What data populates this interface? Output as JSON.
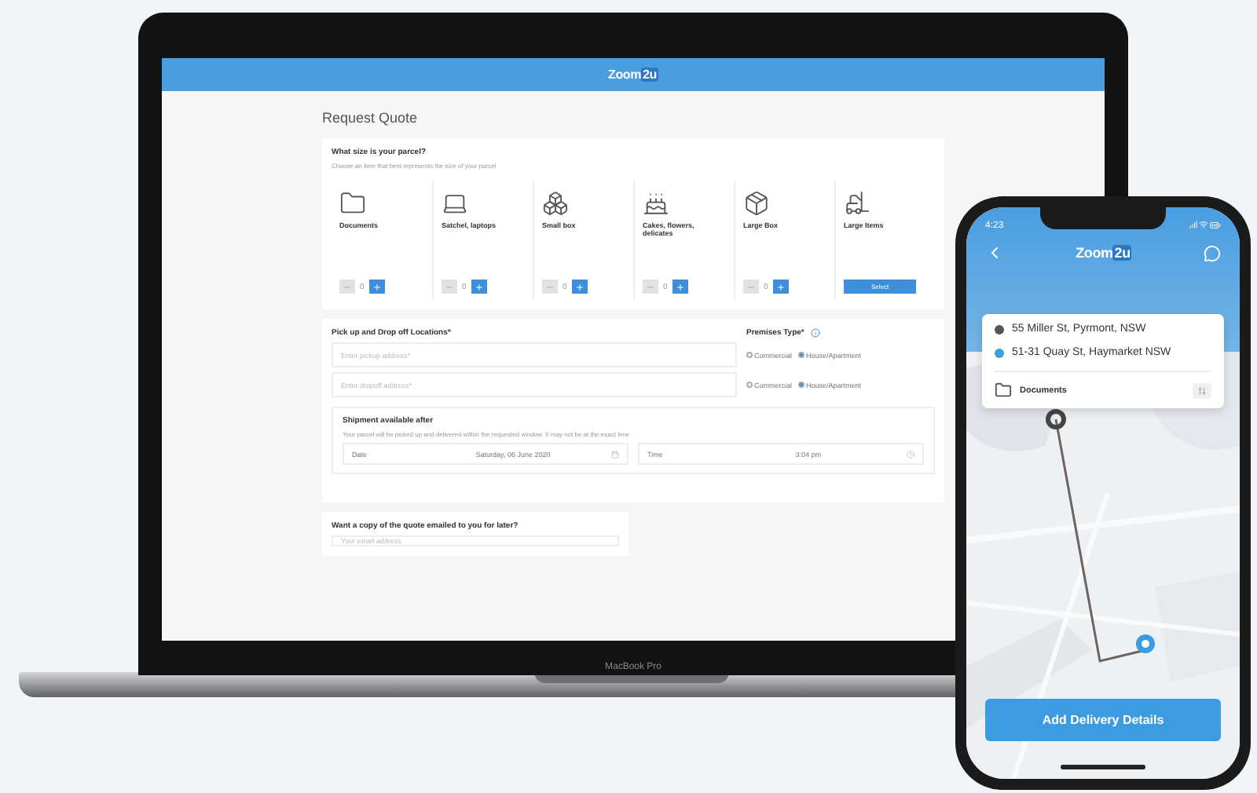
{
  "laptop": {
    "brand": "MacBook Pro",
    "app": {
      "logo": {
        "main": "Zoom",
        "accent": "2u"
      },
      "title": "Request Quote",
      "parcel": {
        "heading": "What size is your parcel?",
        "hint": "Choose an item that best represents the size of your parcel",
        "items": [
          {
            "name": "Documents",
            "kind": "counter",
            "quantity": "0"
          },
          {
            "name": "Satchel, laptops",
            "kind": "counter",
            "quantity": "0"
          },
          {
            "name": "Small box",
            "kind": "counter",
            "quantity": "0"
          },
          {
            "name": "Cakes, flowers, delicates",
            "kind": "counter",
            "quantity": "0"
          },
          {
            "name": "Large Box",
            "kind": "counter",
            "quantity": "0"
          },
          {
            "name": "Large Items",
            "kind": "button",
            "button": "Select"
          }
        ]
      },
      "locations": {
        "heading": "Pick up and Drop off Locations*",
        "premises_heading": "Premises Type*",
        "rows": [
          {
            "placeholder": "Enter pickup address*",
            "options": [
              {
                "label": "Commercial",
                "selected": false
              },
              {
                "label": "House/Apartment",
                "selected": true
              }
            ]
          },
          {
            "placeholder": "Enter dropoff address*",
            "options": [
              {
                "label": "Commercial",
                "selected": false
              },
              {
                "label": "House/Apartment",
                "selected": true
              }
            ]
          }
        ]
      },
      "shipment": {
        "heading": "Shipment available after",
        "note": "Your parcel will be picked up and delivered within the requested window. It may not be at the exact time",
        "fields": [
          {
            "label": "Date",
            "value": "Saturday, 06 June 2020"
          },
          {
            "label": "Time",
            "value": "3:04 pm"
          }
        ]
      },
      "email": {
        "question": "Want a copy of the quote emailed to you for later?",
        "placeholder": "Your email address"
      }
    }
  },
  "phone": {
    "time": "4:23",
    "logo": {
      "main": "Zoom",
      "accent": "2u"
    },
    "stops": [
      {
        "address": "55 Miller St, Pyrmont, NSW",
        "color": "#555555"
      },
      {
        "address": "51-31 Quay St, Haymarket NSW",
        "color": "#3aa0d8"
      }
    ],
    "parcel": "Documents",
    "button": "Add Delivery Details"
  }
}
